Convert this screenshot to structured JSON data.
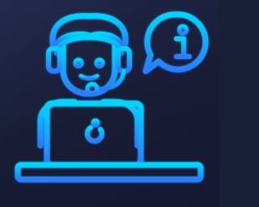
{
  "illustration": {
    "subject": "customer-support-agent-icon",
    "background_color": "#1a1f38",
    "stroke_gradient": [
      "#00d4ff",
      "#2a7bff"
    ],
    "info_glyph": "i"
  }
}
